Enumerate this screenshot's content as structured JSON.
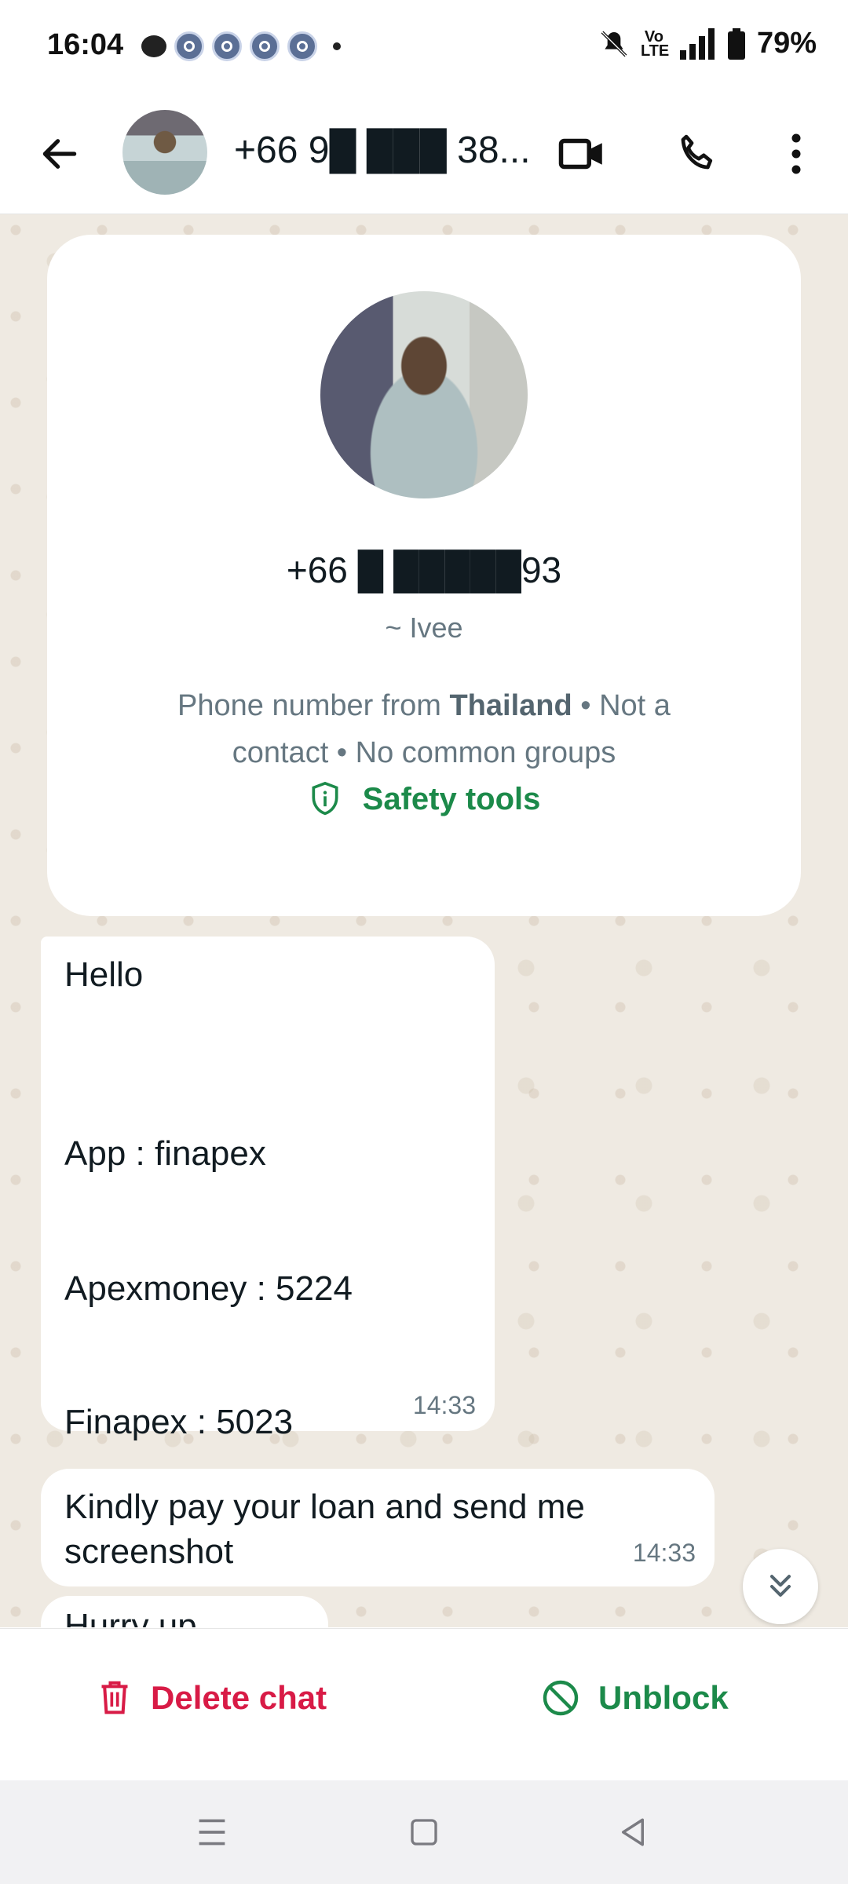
{
  "status_bar": {
    "time": "16:04",
    "volte": "Vo LTE",
    "battery": "79%"
  },
  "header": {
    "title": "+66 9█ ███ 38...",
    "icons": [
      "back-arrow-icon",
      "video-call-icon",
      "voice-call-icon",
      "more-options-icon"
    ]
  },
  "info_card": {
    "phone": "+66 █ █████93",
    "name": "~ Ivee",
    "desc_prefix": "Phone number from ",
    "country": "Thailand",
    "desc_suffix": " • Not a contact • No common groups",
    "safety_label": "Safety tools"
  },
  "messages": [
    {
      "lines": [
        "Hello",
        "App : finapex",
        "Apexmoney : 5224",
        "Finapex : 5023"
      ],
      "time": "14:33"
    },
    {
      "text": "Kindly pay your loan and send me screenshot",
      "time": "14:33"
    },
    {
      "text": "Hurry up"
    }
  ],
  "actions": {
    "delete_label": "Delete chat",
    "unblock_label": "Unblock"
  },
  "colors": {
    "accent_green": "#1c8a4a",
    "delete_red": "#d81b46",
    "chat_bg": "#efeae2"
  }
}
